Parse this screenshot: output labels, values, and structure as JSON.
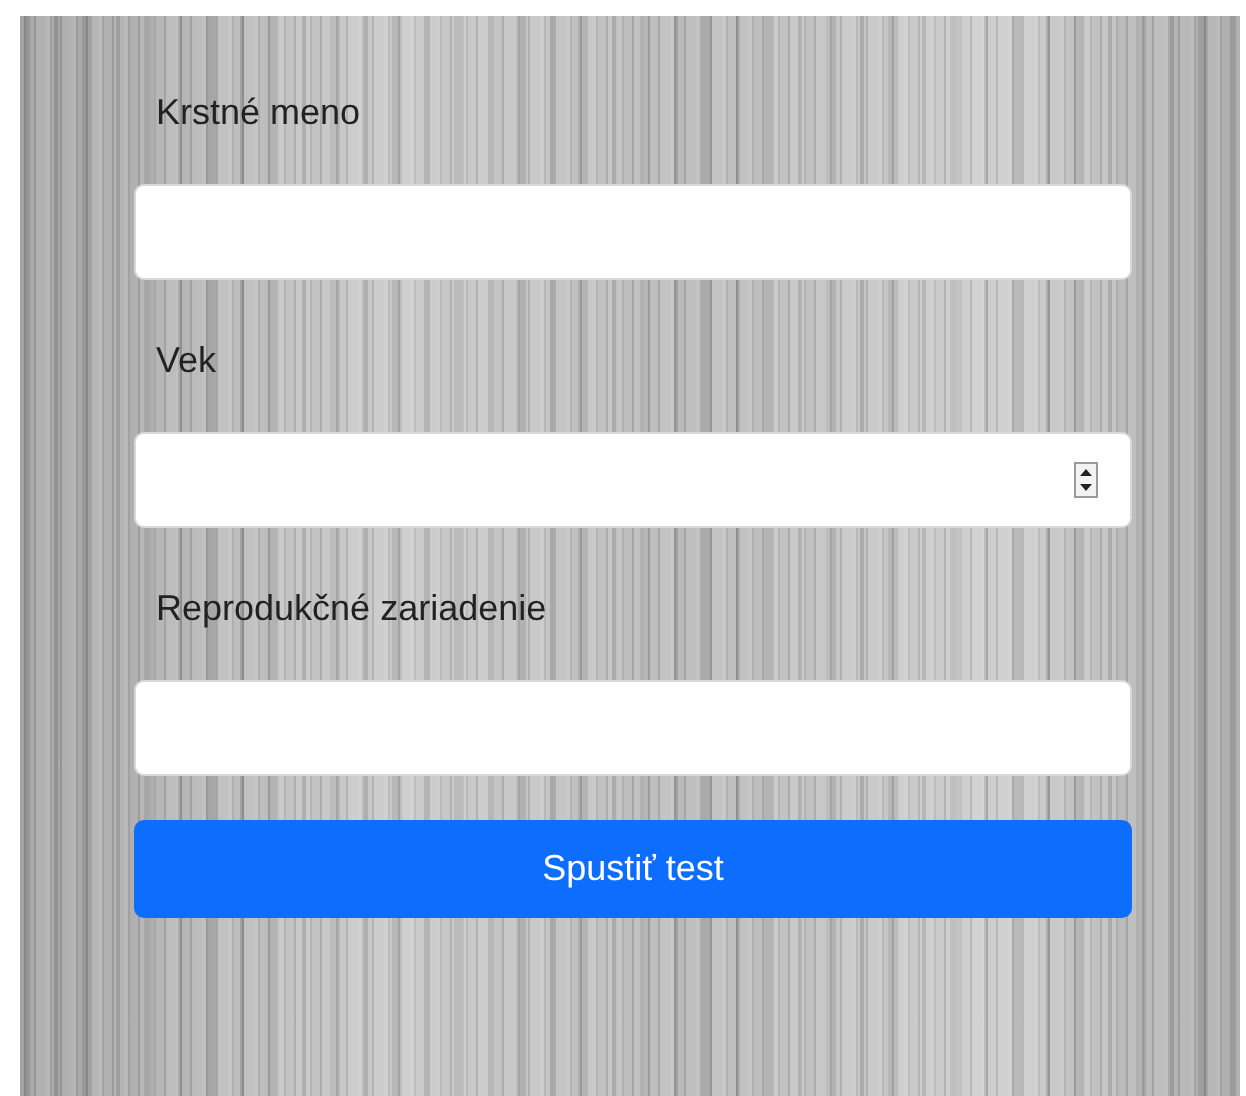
{
  "fields": [
    {
      "label": "Krstné meno",
      "kind": "text"
    },
    {
      "label": "Vek",
      "kind": "number"
    },
    {
      "label": "Reprodukčné zariadenie",
      "kind": "text"
    }
  ],
  "submit_button": {
    "label": "Spustiť test"
  }
}
